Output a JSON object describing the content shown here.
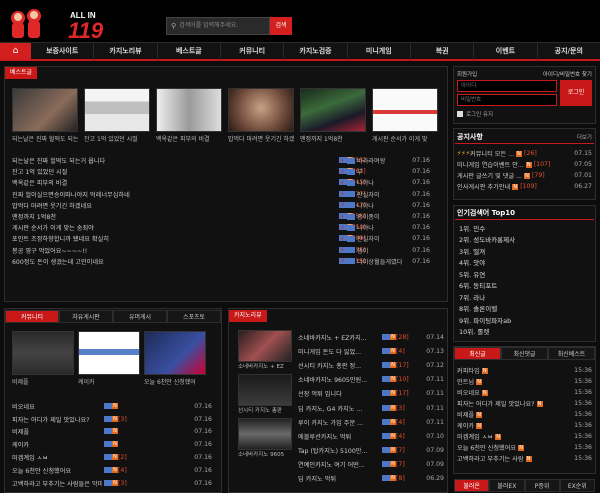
{
  "site": {
    "logo_small": "ALL IN",
    "logo_big": "119"
  },
  "search": {
    "placeholder": "검색어를 입력해주세요.",
    "button": "검색"
  },
  "nav": [
    "보증사이트",
    "카지노리뷰",
    "베스트글",
    "커뮤니티",
    "카지노검증",
    "미니게임",
    "복권",
    "이벤트",
    "공지/문의"
  ],
  "best": {
    "tab": "베스트글",
    "thumbs": [
      "되는날은 진짜 헐떡도 되는거 웁",
      "잔고 1억 있었던 시절",
      "백옥같은 피부의 비결",
      "밥먹다 마려면 웃기긴 하겠",
      "맨정까지 1억8천",
      "게시판 순서가 이게 맞"
    ],
    "rows": [
      {
        "t": "되는날은 진짜 헐떡도 되는거 웁니다",
        "c": "[55]",
        "n": "바라라여왕",
        "d": "07.16"
      },
      {
        "t": "잔고 1억 있었던 시절",
        "c": "[63]",
        "n": "부",
        "d": "07.16"
      },
      {
        "t": "백옥같은 피부의 비결",
        "c": "[45]",
        "n": "나야나",
        "d": "07.16"
      },
      {
        "t": "진짜 헐이실으면승이따나야지 먹레너무심하네",
        "c": "[77]",
        "n": "판실자이",
        "d": "07.16"
      },
      {
        "t": "밥먹다 마려면 웃기긴 하겠네요",
        "c": "[47]",
        "n": "나야나",
        "d": "07.16"
      },
      {
        "t": "맨정까지 1억8천",
        "c": "[55]",
        "n": "종이종이",
        "d": "07.16"
      },
      {
        "t": "게시판 순서가 이게 맞는 숭죄야",
        "c": "[50]",
        "n": "나야나",
        "d": "07.16"
      },
      {
        "t": "포인트 조정하향합니까 됐네요 확실히",
        "c": "[69]",
        "n": "판실자이",
        "d": "07.16"
      },
      {
        "t": "봉공 영구 먹었어요~~~~!!",
        "c": "[55]",
        "n": "챙이",
        "d": "07.16"
      },
      {
        "t": "600정도 돈이 생겼는데 고민이네요",
        "c": "[55]",
        "n": "더미상월들게였다",
        "d": "07.16"
      }
    ]
  },
  "community": {
    "tabs": [
      "커뮤니티",
      "자유게시판",
      "유머게시",
      "스포츠토"
    ],
    "thumbs": [
      "비제플",
      "케이카",
      "오늘 6천만 신청했어"
    ],
    "rows": [
      {
        "t": "비오네요",
        "c": "",
        "d": "07.16"
      },
      {
        "t": "피자는 어디가 제일 맛있나요?",
        "c": "[3]",
        "d": "07.16"
      },
      {
        "t": "비제플",
        "c": "",
        "d": "07.16"
      },
      {
        "t": "케이카",
        "c": "",
        "d": "07.16"
      },
      {
        "t": "미겜계임 ㅅㅂ",
        "c": "[2]",
        "d": "07.16"
      },
      {
        "t": "오늘 6천만 신청했어요",
        "c": "[4]",
        "d": "07.16"
      },
      {
        "t": "고백하라고 부추기는 사람들은 악마이가요?",
        "c": "[3]",
        "d": "07.16"
      }
    ]
  },
  "review": {
    "tab": "카지노리뷰",
    "thumbs": [
      "소네바카지노 + EZ",
      "선시티 카지노 총판",
      "소네바카지노 9605"
    ],
    "rows": [
      {
        "t": "소네바카지노 + EZ카지...",
        "c": "[28]",
        "d": "07.14"
      },
      {
        "t": "미니게임 돈도 다 잃었...",
        "c": "[4]",
        "d": "07.13"
      },
      {
        "t": "선시티 카지노 총판 정...",
        "c": "[17]",
        "d": "07.12"
      },
      {
        "t": "소네바카지노 9605만원...",
        "c": "[10]",
        "d": "07.11"
      },
      {
        "t": "선장 먹튀 입니다",
        "c": "[17]",
        "d": "07.11"
      },
      {
        "t": "딥 카지노, G4 카지노 ...",
        "c": "[3]",
        "d": "07.11"
      },
      {
        "t": "루이 카지노 가입 주문 ...",
        "c": "[4]",
        "d": "07.11"
      },
      {
        "t": "에볼루션카지노 먹튀",
        "c": "[4]",
        "d": "07.10"
      },
      {
        "t": "Tap (탑카지노) 5100만...",
        "c": "[7]",
        "d": "07.09"
      },
      {
        "t": "연예인카지노 여기 어떤...",
        "c": "[7]",
        "d": "07.09"
      },
      {
        "t": "딥 카지노 먹튀",
        "c": "[8]",
        "d": "06.29"
      }
    ]
  },
  "login": {
    "label": "회원가입",
    "find": "아이디/비밀번호 찾기",
    "id_ph": "아이디",
    "pw_ph": "비밀번호",
    "btn": "로그인",
    "keep": "로그인 유지"
  },
  "notice": {
    "title": "공지사항",
    "more": "더보기",
    "rows": [
      {
        "t": "커뮤니티 모든 ...",
        "c": "[26]",
        "d": "07.15"
      },
      {
        "t": "미니게임 연습이벤트 안...",
        "c": "[107]",
        "d": "07.05"
      },
      {
        "t": "게시판 글쓰기 및 댓글 ...",
        "c": "[79]",
        "d": "07.01"
      },
      {
        "t": "인사게시판 추가안내",
        "c": "[109]",
        "d": "06.27"
      }
    ]
  },
  "top10": {
    "title": "인기검색어 Top10",
    "items": [
      "1위. 민수",
      "2위. 성도바카롱제사",
      "3위. 떨져",
      "4위. 앗야",
      "5위. 유연",
      "6위. 동티포트",
      "7위. 라나",
      "8위. 솔론이벨",
      "9위. 파이팅파자ab",
      "10위. 롤렛"
    ]
  },
  "latest": {
    "tabs": [
      "최신글",
      "최신댓글",
      "최신베스트"
    ],
    "rows": [
      {
        "t": "커피타임",
        "d": "15:36"
      },
      {
        "t": "민트님",
        "d": "15:36"
      },
      {
        "t": "비오네요",
        "d": "15:36"
      },
      {
        "t": "피자는 어디가 제일 맛있나요?",
        "d": "15:36"
      },
      {
        "t": "비제플",
        "d": "15:36"
      },
      {
        "t": "케이카",
        "d": "15:36"
      },
      {
        "t": "미겜계임 ㅅㅂ",
        "d": "15:36"
      },
      {
        "t": "오늘 6천만 신청했어요",
        "d": "15:36"
      },
      {
        "t": "고백하라고 부추기는 사람",
        "d": "15:36"
      }
    ]
  },
  "bottom_tabs": [
    "불러온",
    "불러EX",
    "P증위",
    "EX순위"
  ]
}
